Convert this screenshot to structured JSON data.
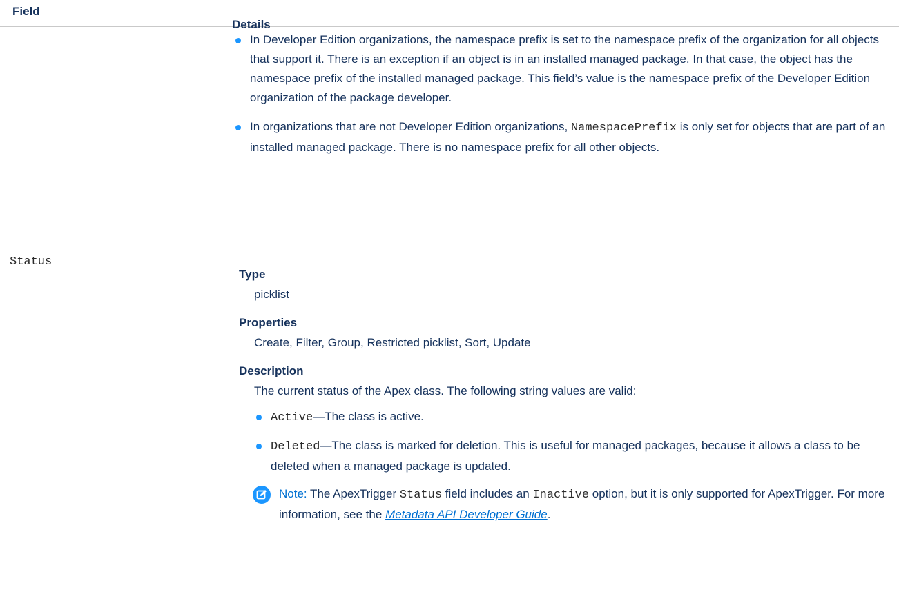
{
  "header": {
    "field_label": "Field",
    "details_label": "Details"
  },
  "row1": {
    "bullet1": "In Developer Edition organizations, the namespace prefix is set to the namespace prefix of the organization for all objects that support it. There is an exception if an object is in an installed managed package. In that case, the object has the namespace prefix of the installed managed package. This field’s value is the namespace prefix of the Developer Edition organization of the package developer.",
    "bullet2_pre": "In organizations that are not Developer Edition organizations, ",
    "bullet2_code": "NamespacePrefix",
    "bullet2_post": " is only set for objects that are part of an installed managed package. There is no namespace prefix for all other objects."
  },
  "row2": {
    "field_name": "Status",
    "type_label": "Type",
    "type_value": "picklist",
    "properties_label": "Properties",
    "properties_value": "Create, Filter, Group, Restricted picklist, Sort, Update",
    "description_label": "Description",
    "description_text": "The current status of the Apex class. The following string values are valid:",
    "values": [
      {
        "code": "Active",
        "text": "—The class is active."
      },
      {
        "code": "Deleted",
        "text": "—The class is marked for deletion. This is useful for managed packages, because it allows a class to be deleted when a managed package is updated."
      }
    ],
    "note": {
      "icon": "edit-note-icon",
      "label": "Note:",
      "t1": " The ApexTrigger ",
      "c1": "Status",
      "t2": " field includes an ",
      "c2": "Inactive",
      "t3": " option, but it is only supported for ApexTrigger. For more information, see the ",
      "link": "Metadata API Developer Guide",
      "t4": "."
    }
  },
  "colors": {
    "accent": "#1b96ff",
    "link": "#0070d2",
    "heading": "#16325c"
  }
}
